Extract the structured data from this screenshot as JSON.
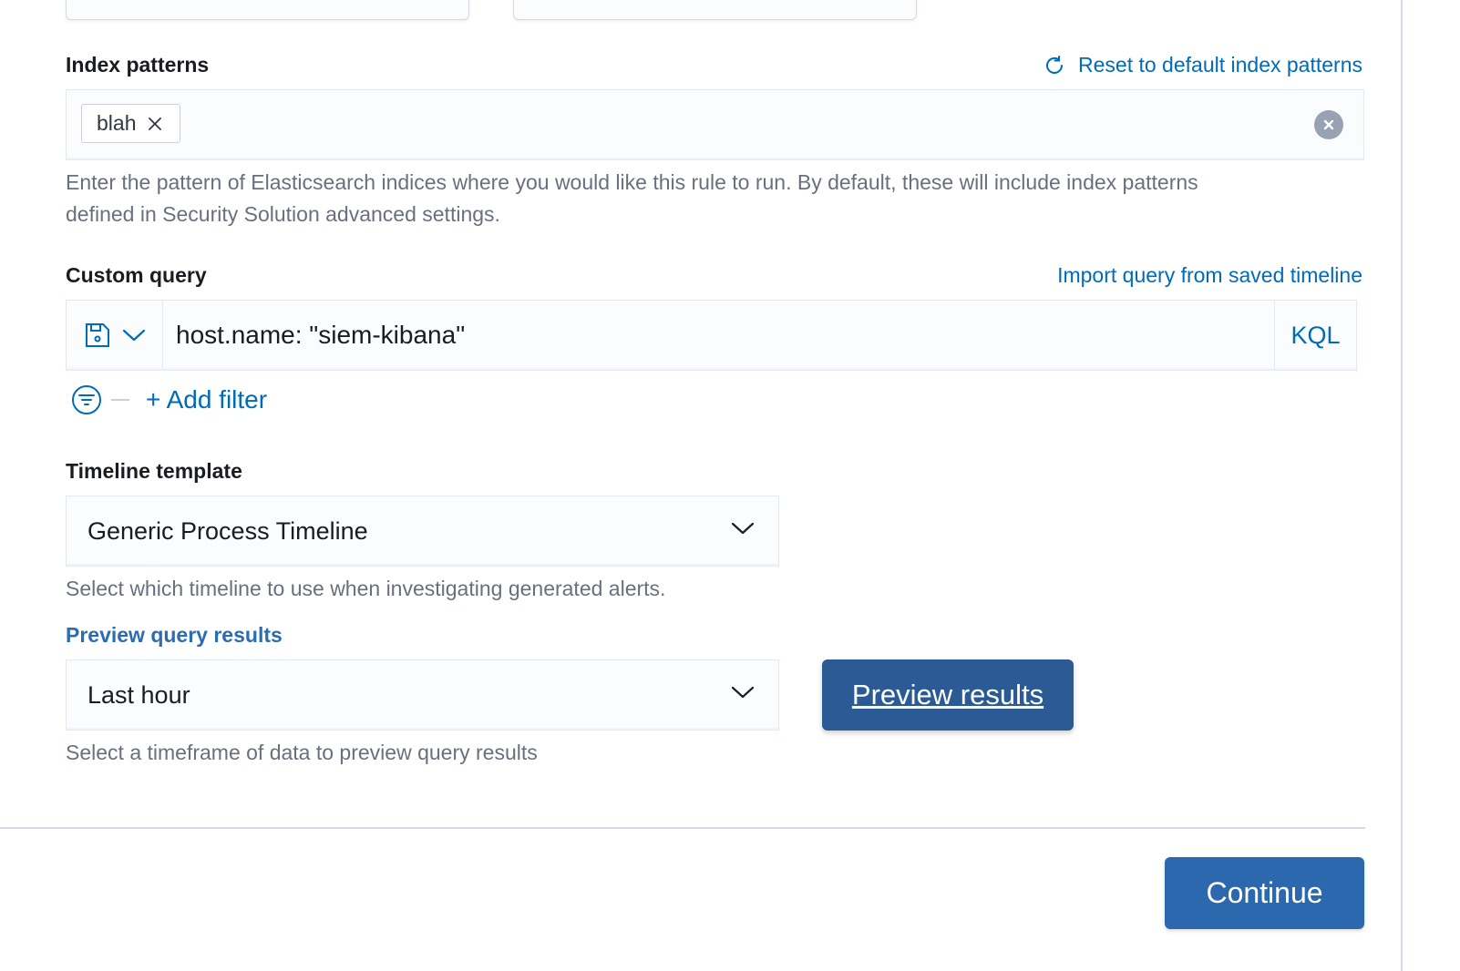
{
  "index_patterns": {
    "label": "Index patterns",
    "reset_link": "Reset to default index patterns",
    "selected": [
      "blah"
    ],
    "help_line1": "Enter the pattern of Elasticsearch indices where you would like this rule to run. By default, these will include index patterns",
    "help_line2": "defined in Security Solution advanced settings."
  },
  "custom_query": {
    "label": "Custom query",
    "import_link": "Import query from saved timeline",
    "query_value": "host.name: \"siem-kibana\"",
    "language": "KQL",
    "add_filter": "+ Add filter"
  },
  "timeline_template": {
    "label": "Timeline template",
    "selected": "Generic Process Timeline",
    "help": "Select which timeline to use when investigating generated alerts."
  },
  "preview": {
    "label": "Preview query results",
    "timeframe": "Last hour",
    "button": "Preview results",
    "help": "Select a timeframe of data to preview query results"
  },
  "footer": {
    "continue": "Continue"
  },
  "colors": {
    "link": "#006bb8",
    "primary_button": "#2c68ad",
    "preview_button": "#2b5a94",
    "label": "#1a1c21",
    "help_text": "#69707d"
  }
}
